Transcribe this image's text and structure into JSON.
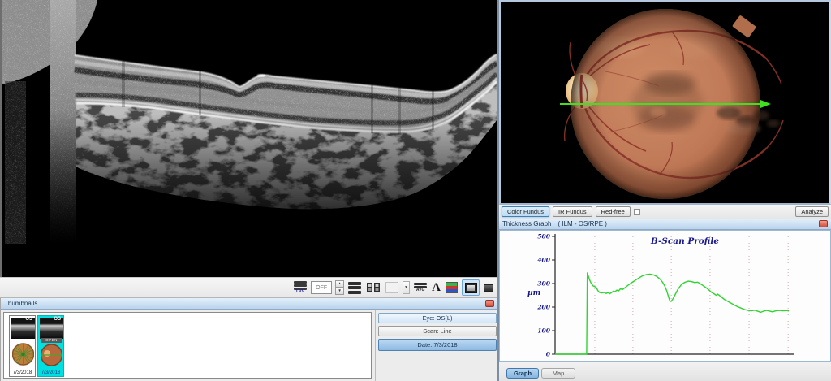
{
  "toolbar": {
    "lvv_label": "LVV",
    "off_value": "OFF",
    "avg_label": "AVG",
    "font_label": "A"
  },
  "thumbnails": {
    "title": "Thumbnails",
    "items": [
      {
        "eye_label": "OS",
        "date": "7/3/2018",
        "scan_type": "radial",
        "selected": false
      },
      {
        "eye_label": "OS",
        "overlay_label": "OPEN",
        "date": "7/3/2018",
        "scan_type": "line",
        "selected": true
      }
    ]
  },
  "scan_info": {
    "eye": "Eye: OS(L)",
    "scan": "Scan: Line",
    "date": "Date: 7/3/2018"
  },
  "fundus": {
    "view_buttons": [
      {
        "label": "Color Fundus",
        "selected": true
      },
      {
        "label": "IR Fundus",
        "selected": false
      },
      {
        "label": "Red-free",
        "selected": false
      }
    ],
    "checkbox_checked": false,
    "analyze_label": "Analyze"
  },
  "thickness_graph": {
    "panel_title": "Thickness Graph",
    "panel_subtitle": "( ILM - OS/RPE )"
  },
  "footer": {
    "tabs": [
      {
        "label": "Graph",
        "selected": true
      },
      {
        "label": "Map",
        "selected": false
      }
    ]
  },
  "colors": {
    "profile_line": "#2fd52f",
    "selection_cyan": "#00e0e0",
    "arrow_green": "#3fe01f",
    "navy_text": "#14148c"
  },
  "chart_data": {
    "type": "line",
    "title": "B-Scan Profile",
    "ylabel": "µm",
    "xlabel": "",
    "ylim": [
      0,
      500
    ],
    "yticks": [
      0,
      100,
      200,
      300,
      400,
      500
    ],
    "x_gridlines_fraction": [
      0.17,
      0.333,
      0.497,
      0.663,
      0.83,
      0.997
    ],
    "grid": "vertical-dotted",
    "legend": "none",
    "series": [
      {
        "name": "ILM - OS/RPE thickness",
        "color": "#2fd52f",
        "points": [
          [
            0.0,
            0
          ],
          [
            0.135,
            0
          ],
          [
            0.138,
            345
          ],
          [
            0.148,
            315
          ],
          [
            0.155,
            300
          ],
          [
            0.163,
            290
          ],
          [
            0.17,
            287
          ],
          [
            0.177,
            282
          ],
          [
            0.183,
            270
          ],
          [
            0.19,
            262
          ],
          [
            0.2,
            260
          ],
          [
            0.21,
            262
          ],
          [
            0.218,
            258
          ],
          [
            0.226,
            261
          ],
          [
            0.234,
            257
          ],
          [
            0.242,
            262
          ],
          [
            0.25,
            268
          ],
          [
            0.257,
            265
          ],
          [
            0.264,
            272
          ],
          [
            0.272,
            269
          ],
          [
            0.28,
            278
          ],
          [
            0.288,
            274
          ],
          [
            0.296,
            280
          ],
          [
            0.305,
            287
          ],
          [
            0.315,
            295
          ],
          [
            0.33,
            305
          ],
          [
            0.345,
            315
          ],
          [
            0.36,
            325
          ],
          [
            0.375,
            333
          ],
          [
            0.39,
            338
          ],
          [
            0.406,
            340
          ],
          [
            0.42,
            337
          ],
          [
            0.435,
            330
          ],
          [
            0.45,
            318
          ],
          [
            0.46,
            305
          ],
          [
            0.47,
            288
          ],
          [
            0.478,
            268
          ],
          [
            0.484,
            248
          ],
          [
            0.489,
            232
          ],
          [
            0.493,
            224
          ],
          [
            0.498,
            226
          ],
          [
            0.505,
            236
          ],
          [
            0.515,
            255
          ],
          [
            0.525,
            275
          ],
          [
            0.54,
            295
          ],
          [
            0.555,
            305
          ],
          [
            0.57,
            310
          ],
          [
            0.585,
            308
          ],
          [
            0.598,
            304
          ],
          [
            0.61,
            306
          ],
          [
            0.62,
            300
          ],
          [
            0.632,
            292
          ],
          [
            0.645,
            283
          ],
          [
            0.658,
            273
          ],
          [
            0.67,
            262
          ],
          [
            0.682,
            255
          ],
          [
            0.69,
            250
          ],
          [
            0.696,
            255
          ],
          [
            0.705,
            248
          ],
          [
            0.715,
            240
          ],
          [
            0.725,
            232
          ],
          [
            0.736,
            226
          ],
          [
            0.75,
            218
          ],
          [
            0.765,
            210
          ],
          [
            0.78,
            202
          ],
          [
            0.795,
            196
          ],
          [
            0.81,
            190
          ],
          [
            0.825,
            186
          ],
          [
            0.84,
            184
          ],
          [
            0.855,
            187
          ],
          [
            0.868,
            182
          ],
          [
            0.88,
            178
          ],
          [
            0.893,
            183
          ],
          [
            0.905,
            186
          ],
          [
            0.918,
            183
          ],
          [
            0.93,
            180
          ],
          [
            0.945,
            184
          ],
          [
            0.96,
            186
          ],
          [
            0.975,
            184
          ],
          [
            0.99,
            185
          ],
          [
            1.0,
            185
          ]
        ]
      }
    ]
  }
}
